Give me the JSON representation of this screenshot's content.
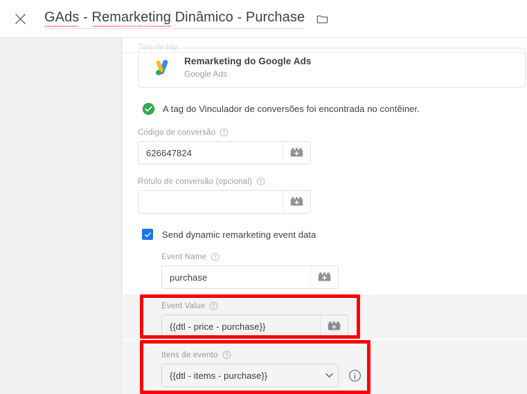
{
  "header": {
    "close_icon": "close-icon",
    "title": "GAds - Remarketing Dinâmico - Purchase",
    "title_parts": {
      "part1": "GAds",
      "sep1": " - ",
      "part2": "Remarketing",
      "rest": " Dinâmico - Purchase"
    },
    "folder_icon": "folder-icon"
  },
  "form": {
    "clipped_section_label": "Tipo de tag",
    "tag_card": {
      "title": "Remarketing do Google Ads",
      "subtitle": "Google Ads",
      "logo_icon": "google-ads-logo"
    },
    "status": {
      "icon": "check-circle-icon",
      "text": "A tag do Vinculador de conversões foi encontrada no contêiner.",
      "color": "#34a853"
    },
    "conversion_id": {
      "label": "Código de conversão",
      "help_icon": "help-circle-icon",
      "value": "626647824",
      "variable_picker_icon": "variable-brick-icon"
    },
    "conversion_label": {
      "label": "Rótulo de conversão (opcional)",
      "help_icon": "help-circle-icon",
      "value": "",
      "placeholder": "",
      "variable_picker_icon": "variable-brick-icon"
    },
    "dynamic_checkbox": {
      "checked": true,
      "label": "Send dynamic remarketing event data",
      "accent": "#1a73e8"
    },
    "event_name": {
      "label": "Event Name",
      "help_icon": "help-circle-icon",
      "value": "purchase",
      "variable_picker_icon": "variable-brick-icon"
    },
    "event_value": {
      "label": "Event Value",
      "help_icon": "help-circle-icon",
      "value": "{{dtl - price - purchase}}",
      "variable_picker_icon": "variable-brick-icon"
    },
    "event_items": {
      "label": "Itens de evento",
      "help_icon": "help-circle-icon",
      "value": "{{dtl - items - purchase}}",
      "caret_icon": "chevron-down-icon",
      "info_icon": "info-circle-icon"
    }
  },
  "annotations": {
    "color": "#fb0007",
    "boxes": [
      {
        "name": "event-value-highlight"
      },
      {
        "name": "event-items-highlight"
      }
    ]
  }
}
